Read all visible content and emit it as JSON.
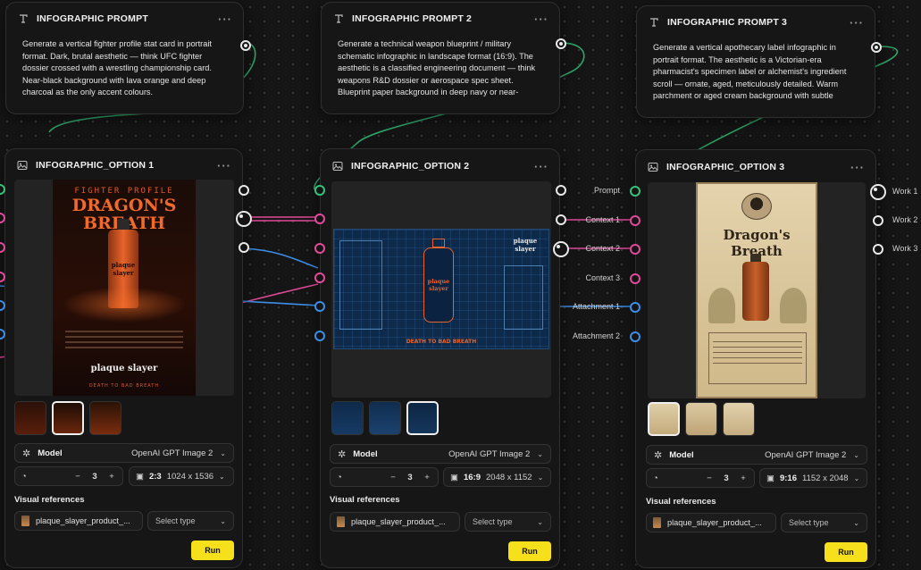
{
  "prompts": [
    {
      "title": "INFOGRAPHIC PROMPT",
      "text": "Generate a vertical fighter profile stat card in portrait format. Dark, brutal aesthetic — think UFC fighter dossier crossed with a wrestling championship card. Near-black background with lava orange and deep charcoal as the only accent colours."
    },
    {
      "title": "INFOGRAPHIC PROMPT 2",
      "text": "Generate a technical weapon blueprint / military schematic infographic in landscape format (16:9). The aesthetic is a classified engineering document — think weapons R&D dossier or aerospace spec sheet. Blueprint paper background in deep navy or near-"
    },
    {
      "title": "INFOGRAPHIC PROMPT 3",
      "text": "Generate a vertical apothecary label infographic in portrait format. The aesthetic is a Victorian-era pharmacist's specimen label or alchemist's ingredient scroll — ornate, aged, meticulously detailed. Warm parchment or aged cream background with subtle"
    }
  ],
  "options": [
    {
      "title": "INFOGRAPHIC_OPTION 1",
      "model_label": "Model",
      "model_value": "OpenAI GPT Image 2",
      "count": "3",
      "ratio": "2:3",
      "size": "1024 x 1536",
      "visual_refs_label": "Visual references",
      "file_name": "plaque_slayer_product_...",
      "select_placeholder": "Select type",
      "run_label": "Run",
      "poster": {
        "eyebrow": "FIGHTER PROFILE",
        "headline": "DRAGON'S BREATH",
        "bottle_text": "plaque slayer",
        "brand": "plaque slayer",
        "tagline": "DEATH TO BAD BREATH"
      }
    },
    {
      "title": "INFOGRAPHIC_OPTION 2",
      "model_label": "Model",
      "model_value": "OpenAI GPT Image 2",
      "count": "3",
      "ratio": "16:9",
      "size": "2048 x 1152",
      "visual_refs_label": "Visual references",
      "file_name": "plaque_slayer_product_...",
      "select_placeholder": "Select type",
      "run_label": "Run",
      "poster": {
        "brand": "plaque slayer",
        "bottle_text": "plaque slayer",
        "tagline": "DEATH TO BAD BREATH"
      }
    },
    {
      "title": "INFOGRAPHIC_OPTION 3",
      "model_label": "Model",
      "model_value": "OpenAI GPT Image 2",
      "count": "3",
      "ratio": "9:16",
      "size": "1152 x 2048",
      "visual_refs_label": "Visual references",
      "file_name": "plaque_slayer_product_...",
      "select_placeholder": "Select type",
      "run_label": "Run",
      "poster": {
        "headline": "Dragon's Breath"
      }
    }
  ],
  "ports_left": [
    "Prompt",
    "Context 1",
    "Context 2",
    "Context 3",
    "Attachment 1",
    "Attachment 2"
  ],
  "ports_right": [
    "Work 1",
    "Work 2",
    "Work 3"
  ],
  "colors": {
    "accent_run": "#f5e01b",
    "port_green": "#35c27c",
    "port_pink": "#e24a9a",
    "port_blue": "#3d8ee8",
    "lava_orange": "#e8632a",
    "blueprint_navy": "#0e2a4a",
    "parchment": "#d9c6a0"
  },
  "icons": {
    "prompt_header": "text-icon",
    "option_header": "image-icon",
    "model": "gear-icon",
    "stepper": "timer-icon",
    "ratio": "aspect-ratio-icon",
    "more": "ellipsis-icon",
    "dropdown": "chevron-down-icon"
  }
}
